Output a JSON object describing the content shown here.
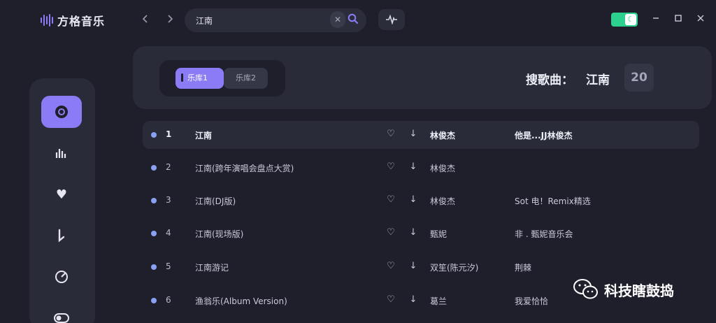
{
  "app": {
    "title": "方格音乐"
  },
  "search": {
    "value": "江南"
  },
  "library_tabs": [
    {
      "label": "乐库1",
      "active": true
    },
    {
      "label": "乐库2",
      "active": false
    }
  ],
  "results": {
    "label": "搜歌曲：",
    "keyword": "江南",
    "count": "20"
  },
  "songs": [
    {
      "index": "1",
      "title": "江南",
      "artist": "林俊杰",
      "album": "他是...JJ林俊杰"
    },
    {
      "index": "2",
      "title": "江南(跨年演唱会盘点大赏)",
      "artist": "林俊杰",
      "album": ""
    },
    {
      "index": "3",
      "title": "江南(DJ版)",
      "artist": "林俊杰",
      "album": "Sot 电！Remix精选"
    },
    {
      "index": "4",
      "title": "江南(现场版)",
      "artist": "甄妮",
      "album": "非 . 甄妮音乐会"
    },
    {
      "index": "5",
      "title": "江南游记",
      "artist": "双笙(陈元汐)",
      "album": "荆棘"
    },
    {
      "index": "6",
      "title": "渔翁乐(Album Version)",
      "artist": "葛兰",
      "album": "我爱恰恰"
    }
  ],
  "icons": {
    "back": "chevron-left-icon",
    "forward": "chevron-right-icon",
    "clear": "close-icon",
    "search": "search-icon",
    "wave": "waveform-icon",
    "theme": "moon-icon",
    "minimize": "minimize-icon",
    "maximize": "maximize-icon",
    "close": "close-icon"
  },
  "colors": {
    "accent": "#8b7cf6",
    "toggle": "#2dd18f",
    "background": "#1e1f2a",
    "panel": "#2a2b38"
  },
  "watermark": {
    "text": "科技瞎鼓捣"
  }
}
